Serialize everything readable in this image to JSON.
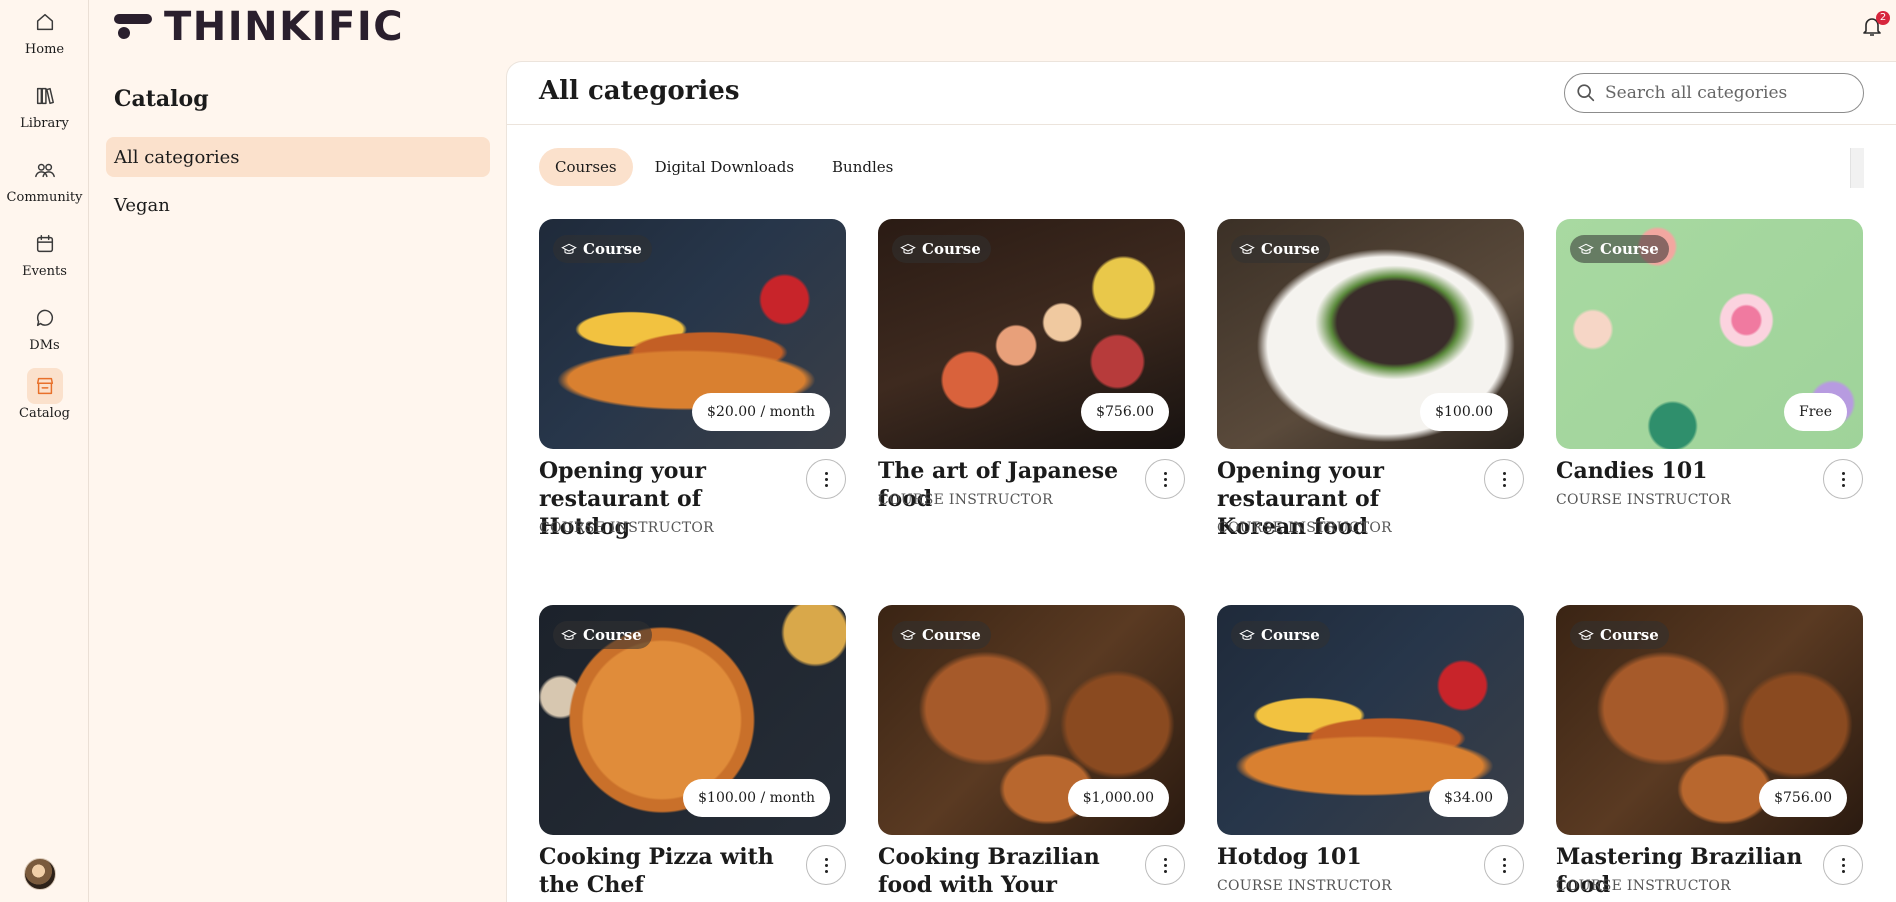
{
  "app": {
    "logo_text": "THINKIFIC",
    "notification_count": "2"
  },
  "rail": {
    "items": [
      {
        "label": "Home",
        "icon": "home-icon"
      },
      {
        "label": "Library",
        "icon": "library-icon"
      },
      {
        "label": "Community",
        "icon": "community-icon"
      },
      {
        "label": "Events",
        "icon": "calendar-icon"
      },
      {
        "label": "DMs",
        "icon": "chat-icon"
      },
      {
        "label": "Catalog",
        "icon": "storefront-icon",
        "active": true
      }
    ]
  },
  "catalog": {
    "title": "Catalog",
    "items": [
      {
        "label": "All categories",
        "active": true
      },
      {
        "label": "Vegan"
      }
    ]
  },
  "main": {
    "title": "All categories",
    "search": {
      "placeholder": "Search all categories",
      "value": ""
    },
    "tabs": [
      {
        "label": "Courses",
        "active": true
      },
      {
        "label": "Digital Downloads"
      },
      {
        "label": "Bundles"
      }
    ]
  },
  "cards": [
    {
      "badge": "Course",
      "price": "$20.00 / month",
      "title": "Opening your restaurant of Hotdog",
      "instructor": "COURSE INSTRUCTOR"
    },
    {
      "badge": "Course",
      "price": "$756.00",
      "title": "The art of Japanese food",
      "instructor": "COURSE INSTRUCTOR"
    },
    {
      "badge": "Course",
      "price": "$100.00",
      "title": "Opening your restaurant of Korean food",
      "instructor": "COURSE INSTRUCTOR"
    },
    {
      "badge": "Course",
      "price": "Free",
      "title": "Candies 101",
      "instructor": "COURSE INSTRUCTOR"
    },
    {
      "badge": "Course",
      "price": "$100.00 / month",
      "title": "Cooking Pizza with the Chef",
      "instructor": ""
    },
    {
      "badge": "Course",
      "price": "$1,000.00",
      "title": "Cooking Brazilian food with Your Instructor",
      "instructor": ""
    },
    {
      "badge": "Course",
      "price": "$34.00",
      "title": "Hotdog 101",
      "instructor": "COURSE INSTRUCTOR"
    },
    {
      "badge": "Course",
      "price": "$756.00",
      "title": "Mastering Brazilian food",
      "instructor": "COURSE INSTRUCTOR"
    }
  ]
}
